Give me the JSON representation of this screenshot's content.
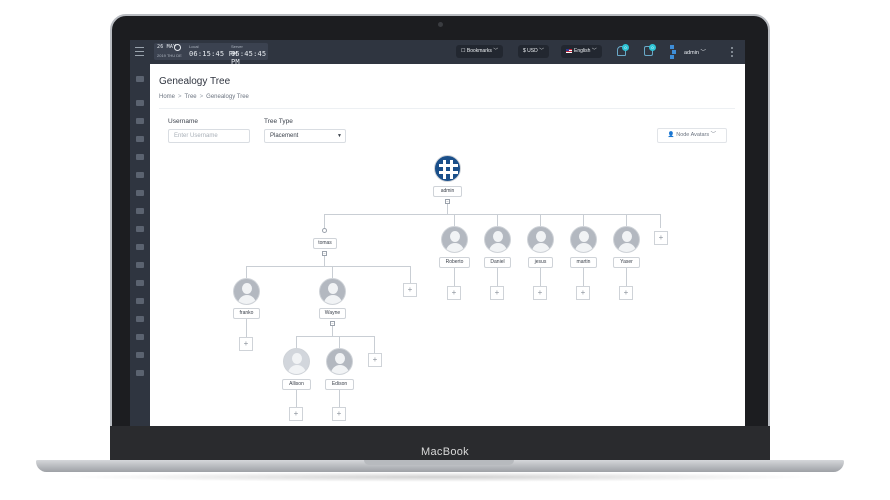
{
  "device": {
    "brand_label": "MacBook"
  },
  "topbar": {
    "date_day": "26 MAY",
    "date_year_weekday": "2019 THU DE",
    "local_label": "Local",
    "local_time": "06:15:45 PM",
    "server_label": "Server",
    "server_time": "05:45:45 PM",
    "bookmarks_label": "Bookmarks",
    "currency_label": "$ USD",
    "language_label": "English",
    "notification_count_1": "0",
    "notification_count_2": "0",
    "user_label": "admin"
  },
  "page": {
    "title": "Genealogy Tree",
    "breadcrumb": [
      "Home",
      "Tree",
      "Genealogy Tree"
    ],
    "username_label": "Username",
    "username_placeholder": "Enter Username",
    "tree_type_label": "Tree Type",
    "tree_type_value": "Placement",
    "node_avatars_label": "Node Avatars"
  },
  "tree": {
    "root": "admin",
    "level1": [
      "tomas",
      "Roberto",
      "Daniel",
      "jesus",
      "martin",
      "Yaser"
    ],
    "tomas_children": [
      "franko",
      "Wayne"
    ],
    "wayne_children": [
      "Allison",
      "Edison"
    ],
    "add_symbol": "+"
  },
  "colors": {
    "sidebar": "#2f3540",
    "topbar": "#2f3540",
    "accent": "#2ec4d6",
    "logo_blue": "#1a4f8a"
  }
}
